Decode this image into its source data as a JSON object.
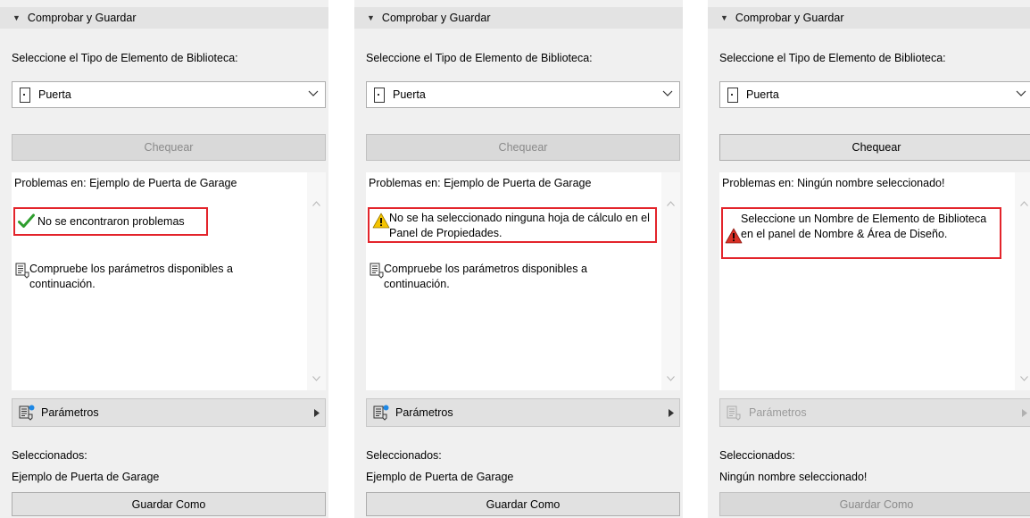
{
  "panels": [
    {
      "header": "Comprobar y Guardar",
      "type_label": "Seleccione el Tipo de Elemento de Biblioteca:",
      "type_value": "Puerta",
      "check_button": "Chequear",
      "check_enabled": false,
      "problems_title": "Problemas en: Ejemplo de Puerta de Garage",
      "status_icon": "check-icon",
      "message": "No se encontraron problemas",
      "info_text": "Compruebe los parámetros disponibles a continuación.",
      "params_label": "Parámetros",
      "params_enabled": true,
      "selected_label": "Seleccionados:",
      "selected_value": "Ejemplo de Puerta de Garage",
      "save_button": "Guardar Como",
      "save_enabled": true
    },
    {
      "header": "Comprobar y Guardar",
      "type_label": "Seleccione el Tipo de Elemento de Biblioteca:",
      "type_value": "Puerta",
      "check_button": "Chequear",
      "check_enabled": false,
      "problems_title": "Problemas en: Ejemplo de Puerta de Garage",
      "status_icon": "warning-icon",
      "message": "No se ha seleccionado ninguna hoja de cálculo en el Panel de Propiedades.",
      "info_text": "Compruebe los parámetros disponibles a continuación.",
      "params_label": "Parámetros",
      "params_enabled": true,
      "selected_label": "Seleccionados:",
      "selected_value": "Ejemplo de Puerta de Garage",
      "save_button": "Guardar Como",
      "save_enabled": true
    },
    {
      "header": "Comprobar y Guardar",
      "type_label": "Seleccione el Tipo de Elemento de Biblioteca:",
      "type_value": "Puerta",
      "check_button": "Chequear",
      "check_enabled": true,
      "problems_title": "Problemas en: Ningún nombre seleccionado!",
      "status_icon": "error-icon",
      "message": "Seleccione un Nombre de Elemento de Biblioteca en el panel de Nombre & Área de Diseño.",
      "info_text": "",
      "params_label": "Parámetros",
      "params_enabled": false,
      "selected_label": "Seleccionados:",
      "selected_value": "Ningún nombre seleccionado!",
      "save_button": "Guardar Como",
      "save_enabled": false
    }
  ],
  "colors": {
    "highlight_border": "#e3242b",
    "check_green": "#2e9e2e",
    "warning_yellow": "#f5c400",
    "error_red": "#d93025"
  }
}
